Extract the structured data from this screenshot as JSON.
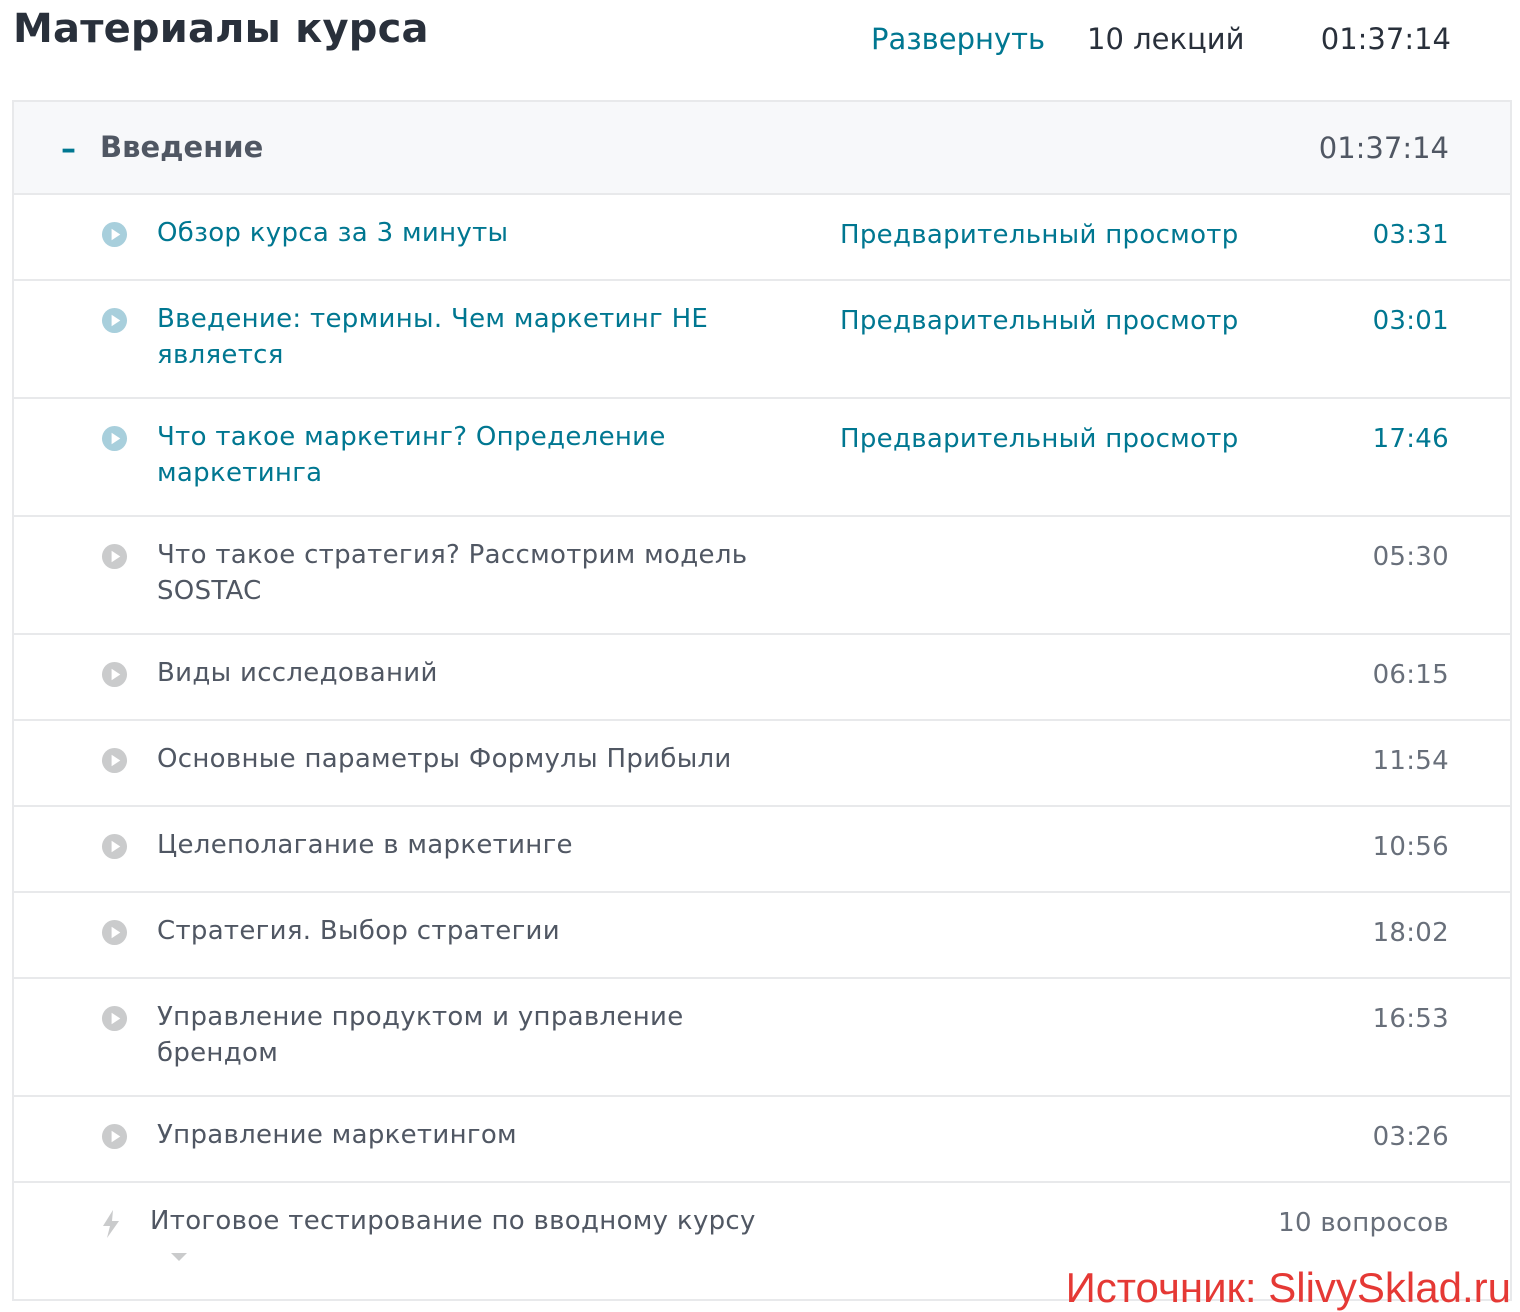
{
  "header": {
    "title": "Материалы курса",
    "expand_label": "Развернуть",
    "lecture_count": "10 лекций",
    "total_time": "01:37:14"
  },
  "section": {
    "collapse_symbol": "–",
    "title": "Введение",
    "time": "01:37:14"
  },
  "lectures": [
    {
      "title": "Обзор курса за 3 минуты",
      "preview_label": "Предварительный просмотр",
      "time": "03:31"
    },
    {
      "title": "Введение: термины. Чем маркетинг НЕ является",
      "preview_label": "Предварительный просмотр",
      "time": "03:01"
    },
    {
      "title": "Что такое маркетинг? Определение маркетинга",
      "preview_label": "Предварительный просмотр",
      "time": "17:46"
    },
    {
      "title": "Что такое стратегия? Рассмотрим модель SOSTAC",
      "time": "05:30"
    },
    {
      "title": "Виды исследований",
      "time": "06:15"
    },
    {
      "title": "Основные параметры Формулы Прибыли",
      "time": "11:54"
    },
    {
      "title": "Целеполагание в маркетинге",
      "time": "10:56"
    },
    {
      "title": "Стратегия. Выбор стратегии",
      "time": "18:02"
    },
    {
      "title": "Управление продуктом и управление брендом",
      "time": "16:53"
    },
    {
      "title": "Управление маркетингом",
      "time": "03:26"
    }
  ],
  "quiz": {
    "title": "Итоговое тестирование по вводному курсу",
    "count": "10 вопросов"
  },
  "watermark": "Источник: SlivySklad.ru",
  "colors": {
    "accent": "#007791",
    "play_icon_preview": "#a8cfdc",
    "play_icon_locked": "#cacbcc",
    "section_bg": "#f7f8fa",
    "watermark": "#e53935"
  },
  "icons": {
    "lecture": "play-circle-icon",
    "quiz": "lightning-bolt-icon",
    "section_toggle": "minus-icon",
    "quiz_toggle": "caret-down-icon"
  }
}
